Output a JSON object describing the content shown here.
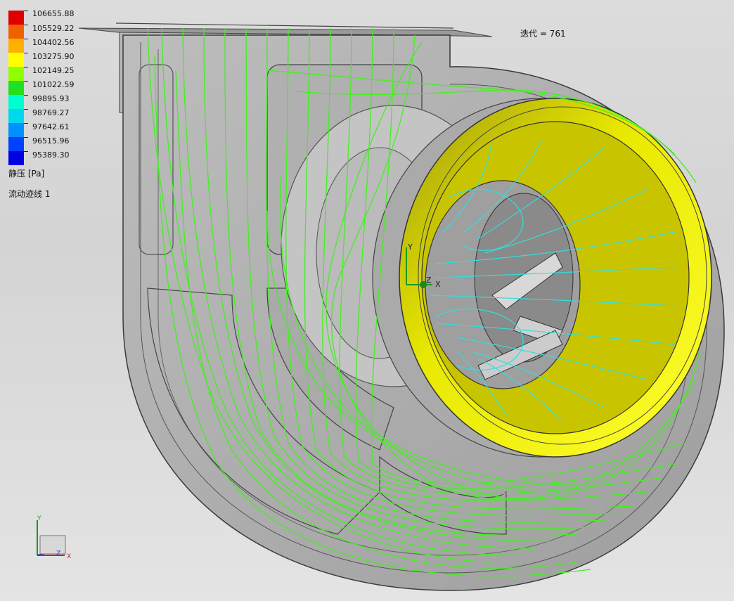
{
  "legend": {
    "values": [
      "106655.88",
      "105529.22",
      "104402.56",
      "103275.90",
      "102149.25",
      "101022.59",
      "99895.93",
      "98769.27",
      "97642.61",
      "96515.96",
      "95389.30"
    ],
    "colors": [
      "#e00000",
      "#f06000",
      "#ffb000",
      "#ffff00",
      "#90ff00",
      "#20e020",
      "#00ffd0",
      "#00d8f0",
      "#0090ff",
      "#0040ff",
      "#0000e0"
    ],
    "quantity_label": "静压 [Pa]",
    "trace_label": "流动迹线 1"
  },
  "iteration_label": "迭代 = 761",
  "triad": {
    "x": "X",
    "y": "Y",
    "z": "Z"
  },
  "colors": {
    "streamline": "#44ee22",
    "inner_streamline": "#33dddd",
    "inlet": "#ffff00",
    "housing": "#a8a8a8"
  }
}
